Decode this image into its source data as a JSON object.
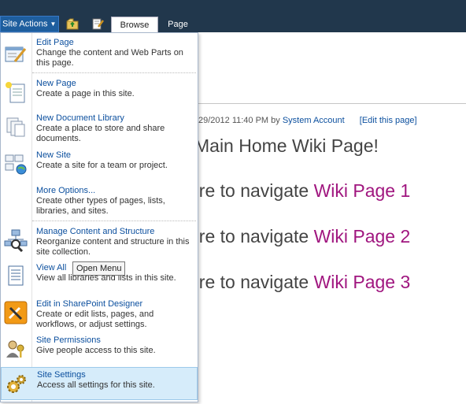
{
  "ribbon": {
    "site_actions_label": "Site Actions",
    "tabs": [
      "Browse",
      "Page"
    ]
  },
  "page": {
    "meta_prefix": "29/2012 11:40 PM by",
    "meta_account": "System Account",
    "meta_edit": "[Edit this page]",
    "headline": "Main Home Wiki Page!",
    "nav_prefix": "ere to navigate",
    "links": [
      "Wiki Page 1",
      "Wiki Page 2",
      "Wiki Page 3"
    ]
  },
  "menu": {
    "items": [
      {
        "title": "Edit Page",
        "desc": "Change the content and Web Parts on this page.",
        "icon": "edit-page-icon"
      },
      {
        "title": "New Page",
        "desc": "Create a page in this site.",
        "icon": "new-page-icon"
      },
      {
        "title": "New Document Library",
        "desc": "Create a place to store and share documents.",
        "icon": "document-library-icon"
      },
      {
        "title": "New Site",
        "desc": "Create a site for a team or project.",
        "icon": "new-site-icon"
      },
      {
        "title": "More Options...",
        "desc": "Create other types of pages, lists, libraries, and sites.",
        "icon": ""
      },
      {
        "title": "Manage Content and Structure",
        "desc": "Reorganize content and structure in this site collection.",
        "icon": "site-structure-icon"
      },
      {
        "title": "View All",
        "desc": "View all libraries and lists in this site.",
        "icon": "view-all-icon"
      },
      {
        "title": "Edit in SharePoint Designer",
        "desc": "Create or edit lists, pages, and workflows, or adjust settings.",
        "icon": "sharepoint-designer-icon"
      },
      {
        "title": "Site Permissions",
        "desc": "Give people access to this site.",
        "icon": "permissions-icon"
      },
      {
        "title": "Site Settings",
        "desc": "Access all settings for this site.",
        "icon": "settings-icon"
      }
    ]
  },
  "tooltip": "Open Menu",
  "colors": {
    "ribbon": "#21374c",
    "link": "#0b4f9e",
    "wiki_link": "#a0167f",
    "highlight": "#d6ecfa"
  }
}
